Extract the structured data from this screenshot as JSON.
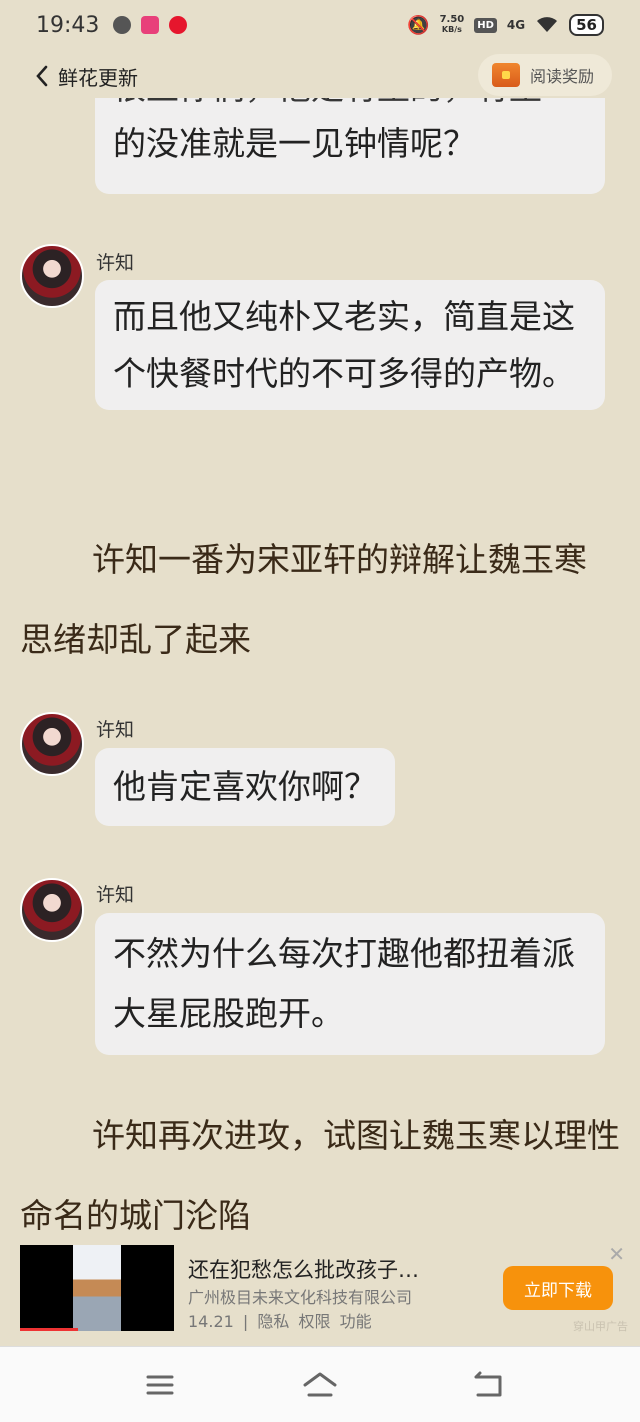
{
  "status": {
    "time": "19:43",
    "net_speed": "7.50",
    "net_unit": "KB/s",
    "hd": "HD",
    "signal": "4G",
    "battery": "56"
  },
  "header": {
    "back_label": "鲜花更新",
    "reward_label": "阅读奖励"
  },
  "messages": [
    {
      "speaker": "",
      "text": "的没准就是一见钟情呢？",
      "top_partial": "很上你们，他是有型的，有型"
    },
    {
      "speaker": "许知",
      "text": "而且他又纯朴又老实，简直是这个快餐时代的不可多得的产物。"
    },
    {
      "speaker": "许知",
      "text": "他肯定喜欢你啊？"
    },
    {
      "speaker": "许知",
      "text": "不然为什么每次打趣他都扭着派大星屁股跑开。"
    }
  ],
  "narration": [
    "许知一番为宋亚轩的辩解让魏玉寒思绪却乱了起来",
    "许知再次进攻，试图让魏玉寒以理性命名的城门沦陷"
  ],
  "ad": {
    "title": "还在犯愁怎么批改孩子…",
    "company": "广州极目未来文化科技有限公司",
    "version": "14.21",
    "privacy": "隐私",
    "permissions": "权限",
    "features": "功能",
    "button": "立即下载",
    "close": "✕",
    "label": "穿山甲广告"
  }
}
